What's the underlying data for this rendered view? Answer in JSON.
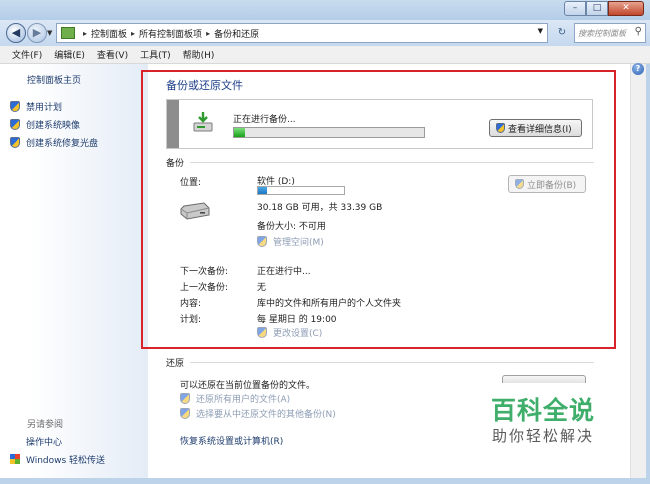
{
  "window": {
    "minimize": "–",
    "maximize": "□",
    "close": "✕"
  },
  "address_bar": {
    "breadcrumbs": [
      "控制面板",
      "所有控制面板项",
      "备份和还原"
    ],
    "search_placeholder": "搜索控制面板"
  },
  "menu": [
    "文件(F)",
    "编辑(E)",
    "查看(V)",
    "工具(T)",
    "帮助(H)"
  ],
  "sidebar": {
    "home": "控制面板主页",
    "tasks": [
      "禁用计划",
      "创建系统映像",
      "创建系统修复光盘"
    ],
    "see_also_label": "另请参阅",
    "links": [
      "操作中心",
      "Windows 轻松传送"
    ]
  },
  "main": {
    "title": "备份或还原文件",
    "progress": {
      "status": "正在进行备份...",
      "fraction": 0.06,
      "details_button": "查看详细信息(I)"
    },
    "backup": {
      "section": "备份",
      "location_label": "位置:",
      "drive_name": "软件 (D:)",
      "used_fraction": 0.1,
      "space": "30.18 GB 可用，共 33.39 GB",
      "size": "备份大小: 不可用",
      "manage_space": "管理空间(M)",
      "backup_now": "立即备份(B)",
      "next_label": "下一次备份:",
      "next_value": "正在进行中...",
      "last_label": "上一次备份:",
      "last_value": "无",
      "contents_label": "内容:",
      "contents_value": "库中的文件和所有用户的个人文件夹",
      "schedule_label": "计划:",
      "schedule_value": "每 星期日 的 19:00",
      "change_settings": "更改设置(C)"
    },
    "restore": {
      "section": "还原",
      "description": "可以还原在当前位置备份的文件。",
      "restore_all": "还原所有用户的文件(A)",
      "select_other": "选择要从中还原文件的其他备份(N)",
      "recover_system": "恢复系统设置或计算机(R)"
    }
  },
  "watermark": {
    "main": "百科全说",
    "sub": "助你轻松解决"
  }
}
